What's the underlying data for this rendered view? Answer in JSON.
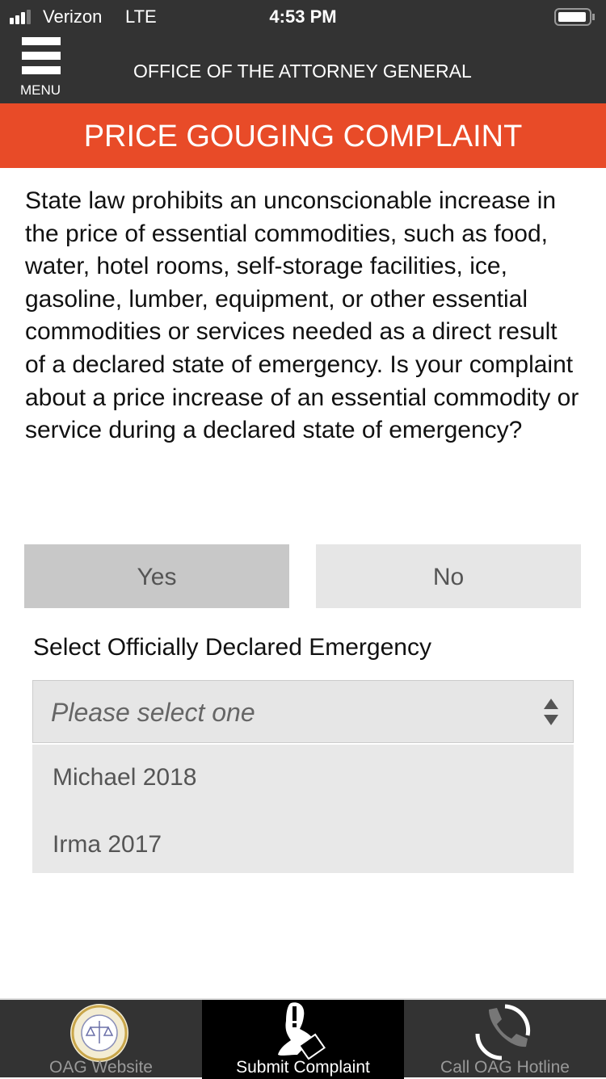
{
  "status": {
    "carrier": "Verizon",
    "network": "LTE",
    "time": "4:53 PM",
    "signal_bars": 3,
    "battery_icon": "battery-icon"
  },
  "header": {
    "menu_label": "MENU",
    "title": "OFFICE OF THE ATTORNEY GENERAL"
  },
  "banner": {
    "title": "PRICE GOUGING COMPLAINT",
    "color": "#e84b28"
  },
  "intro": "State law prohibits an unconscionable increase in the price of essential commodities, such as food, water, hotel rooms, self-storage facilities, ice, gasoline, lumber, equipment, or other essential commodities or services needed as a direct result of a declared state of emergency. Is your complaint about a price increase of an essential commodity or service during a declared state of emergency?",
  "answer": {
    "yes": "Yes",
    "no": "No",
    "selected": "Yes"
  },
  "emergency": {
    "label": "Select Officially Declared Emergency",
    "placeholder": "Please select one",
    "options": [
      "Michael 2018",
      "Irma 2017"
    ]
  },
  "tabs": [
    {
      "label": "OAG Website",
      "icon": "seal-icon"
    },
    {
      "label": "Submit Complaint",
      "icon": "complaint-icon",
      "active": true
    },
    {
      "label": "Call OAG Hotline",
      "icon": "phone-icon"
    }
  ]
}
